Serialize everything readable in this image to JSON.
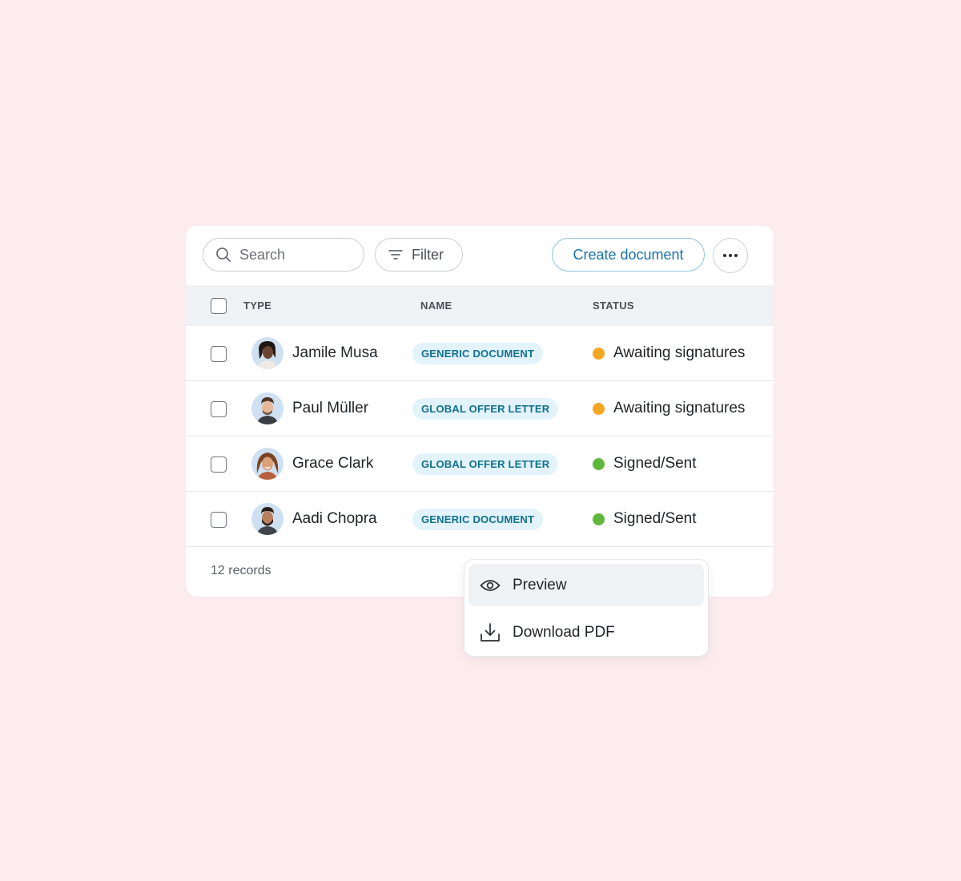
{
  "toolbar": {
    "search_placeholder": "Search",
    "filter_label": "Filter",
    "create_label": "Create document",
    "more_icon": "more-horizontal-icon"
  },
  "table": {
    "columns": [
      "TYPE",
      "NAME",
      "STATUS"
    ],
    "rows": [
      {
        "person": "Jamile Musa",
        "type": "GENERIC DOCUMENT",
        "status": "Awaiting signatures",
        "status_color": "#f5a623"
      },
      {
        "person": "Paul Müller",
        "type": "GLOBAL OFFER LETTER",
        "status": "Awaiting signatures",
        "status_color": "#f5a623"
      },
      {
        "person": "Grace Clark",
        "type": "GLOBAL OFFER LETTER",
        "status": "Signed/Sent",
        "status_color": "#5fb83a"
      },
      {
        "person": "Aadi Chopra",
        "type": "GENERIC DOCUMENT",
        "status": "Signed/Sent",
        "status_color": "#5fb83a"
      }
    ],
    "footer": "12 records"
  },
  "menu": {
    "items": [
      {
        "label": "Preview",
        "icon": "eye-icon"
      },
      {
        "label": "Download PDF",
        "icon": "download-icon"
      }
    ]
  },
  "colors": {
    "background": "#fcecee",
    "accent": "#1a73a8",
    "badge_bg": "#e2f3fb",
    "badge_text": "#10708f"
  }
}
